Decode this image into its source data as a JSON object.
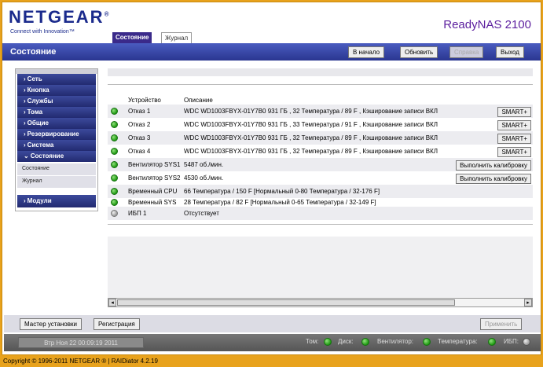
{
  "header": {
    "logo": "NETGEAR",
    "logo_mark": "®",
    "tagline": "Connect with Innovation™",
    "product": "ReadyNAS 2100",
    "tabs": [
      {
        "label": "Состояние",
        "active": true
      },
      {
        "label": "Журнал",
        "active": false
      }
    ]
  },
  "titlebar": {
    "title": "Состояние",
    "buttons": {
      "home": "В начало",
      "refresh": "Обновить",
      "help": "Справка",
      "logout": "Выход"
    }
  },
  "sidebar": {
    "items": [
      {
        "label": "Сеть",
        "arrow": "›"
      },
      {
        "label": "Кнопка",
        "arrow": "›"
      },
      {
        "label": "Службы",
        "arrow": "›"
      },
      {
        "label": "Тома",
        "arrow": "›"
      },
      {
        "label": "Общие",
        "arrow": "›"
      },
      {
        "label": "Резервирование",
        "arrow": "›"
      },
      {
        "label": "Система",
        "arrow": "›"
      },
      {
        "label": "Состояние",
        "arrow": "⌄"
      }
    ],
    "subitems": [
      {
        "label": "Состояние"
      },
      {
        "label": "Журнал"
      }
    ],
    "modules": {
      "label": "Модули",
      "arrow": "›"
    }
  },
  "table": {
    "headers": {
      "device": "Устройство",
      "description": "Описание"
    },
    "rows": [
      {
        "status": "green",
        "device": "Отказ 1",
        "description": "WDC WD1003FBYX-01Y7B0 931 ГБ , 32 Температура / 89 F , Кэширование записи ВКЛ",
        "button": "SMART+"
      },
      {
        "status": "green",
        "device": "Отказ 2",
        "description": "WDC WD1003FBYX-01Y7B0 931 ГБ , 33 Температура / 91 F , Кэширование записи ВКЛ",
        "button": "SMART+"
      },
      {
        "status": "green",
        "device": "Отказ 3",
        "description": "WDC WD1003FBYX-01Y7B0 931 ГБ , 32 Температура / 89 F , Кэширование записи ВКЛ",
        "button": "SMART+"
      },
      {
        "status": "green",
        "device": "Отказ 4",
        "description": "WDC WD1003FBYX-01Y7B0 931 ГБ , 32 Температура / 89 F , Кэширование записи ВКЛ",
        "button": "SMART+"
      },
      {
        "status": "green",
        "device": "Вентилятор SYS1",
        "description": "5487 об./мин.",
        "button": "Выполнить калибровку"
      },
      {
        "status": "green",
        "device": "Вентилятор SYS2",
        "description": "4530 об./мин.",
        "button": "Выполнить калибровку"
      },
      {
        "status": "green",
        "device": "Временный CPU",
        "description": "66 Температура / 150 F [Нормальный 0-80 Температура / 32-176 F]",
        "button": ""
      },
      {
        "status": "green",
        "device": "Временный SYS",
        "description": "28 Температура / 82 F [Нормальный 0-65 Температура / 32-149 F]",
        "button": ""
      },
      {
        "status": "gray",
        "device": "ИБП 1",
        "description": "Отсутствует",
        "button": ""
      }
    ]
  },
  "bottom": {
    "wizard": "Мастер установки",
    "register": "Регистрация",
    "apply": "Применить"
  },
  "statusbar": {
    "datetime": "Втр Ноя 22  00:09:19 2011",
    "indicators": [
      {
        "label": "Том:",
        "status": "green"
      },
      {
        "label": "Диск:",
        "status": "green"
      },
      {
        "label": "Вентилятор:",
        "status": "green"
      },
      {
        "label": "Температура:",
        "status": "green"
      },
      {
        "label": "ИБП:",
        "status": "gray"
      }
    ]
  },
  "footer": {
    "copyright": "Copyright © 1996-2011 NETGEAR ® | RAIDiator 4.2.19"
  },
  "colors": {
    "brand_blue": "#1a2a8c",
    "product_purple": "#5b1e9e",
    "page_orange": "#e8a21c",
    "status_green": "#1f9a12"
  }
}
